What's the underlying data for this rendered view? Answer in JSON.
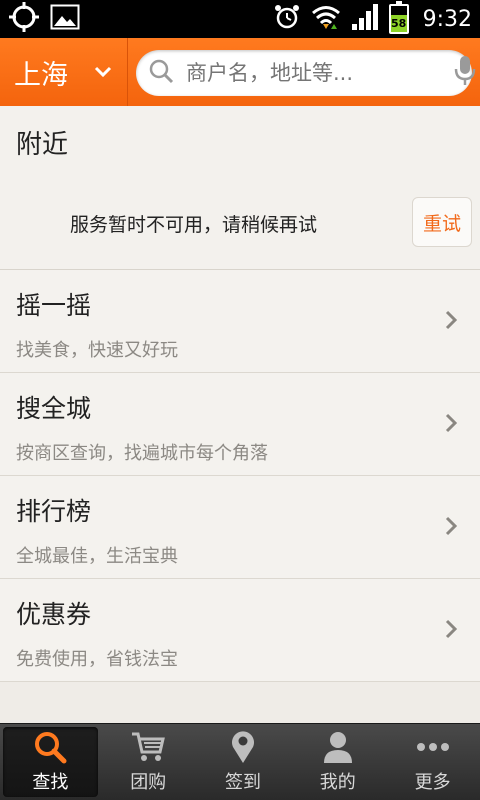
{
  "status_bar": {
    "time": "9:32",
    "battery_level": "58",
    "icons": [
      "gps-icon",
      "image-icon",
      "alarm-icon",
      "wifi-icon",
      "signal-icon",
      "battery-icon"
    ]
  },
  "header": {
    "city": "上海",
    "search_placeholder": "商户名，地址等..."
  },
  "nearby": {
    "title": "附近",
    "message": "服务暂时不可用，请稍候再试",
    "retry_label": "重试"
  },
  "menu": {
    "items": [
      {
        "title": "摇一摇",
        "subtitle": "找美食，快速又好玩"
      },
      {
        "title": "搜全城",
        "subtitle": "按商区查询，找遍城市每个角落"
      },
      {
        "title": "排行榜",
        "subtitle": "全城最佳，生活宝典"
      },
      {
        "title": "优惠券",
        "subtitle": "免费使用，省钱法宝"
      }
    ]
  },
  "tabs": [
    {
      "label": "查找",
      "icon": "search-icon",
      "active": true
    },
    {
      "label": "团购",
      "icon": "cart-icon",
      "active": false
    },
    {
      "label": "签到",
      "icon": "location-pin-icon",
      "active": false
    },
    {
      "label": "我的",
      "icon": "user-icon",
      "active": false
    },
    {
      "label": "更多",
      "icon": "more-dots-icon",
      "active": false
    }
  ],
  "colors": {
    "accent": "#f26a1b",
    "header_orange": "#ff7a1f",
    "battery_green": "#8ed327",
    "tab_bar": "#333333"
  }
}
